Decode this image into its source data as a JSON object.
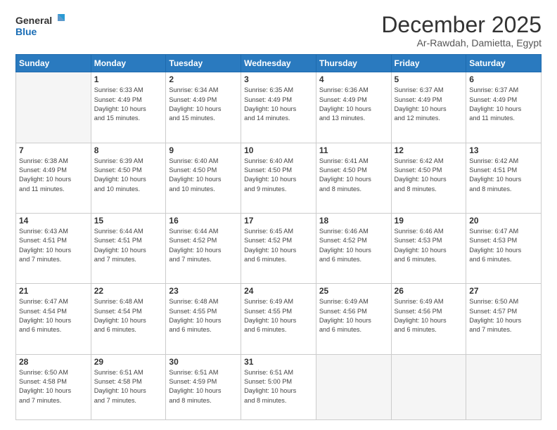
{
  "logo": {
    "line1": "General",
    "line2": "Blue"
  },
  "title": "December 2025",
  "location": "Ar-Rawdah, Damietta, Egypt",
  "days_of_week": [
    "Sunday",
    "Monday",
    "Tuesday",
    "Wednesday",
    "Thursday",
    "Friday",
    "Saturday"
  ],
  "weeks": [
    [
      {
        "day": "",
        "info": ""
      },
      {
        "day": "1",
        "info": "Sunrise: 6:33 AM\nSunset: 4:49 PM\nDaylight: 10 hours\nand 15 minutes."
      },
      {
        "day": "2",
        "info": "Sunrise: 6:34 AM\nSunset: 4:49 PM\nDaylight: 10 hours\nand 15 minutes."
      },
      {
        "day": "3",
        "info": "Sunrise: 6:35 AM\nSunset: 4:49 PM\nDaylight: 10 hours\nand 14 minutes."
      },
      {
        "day": "4",
        "info": "Sunrise: 6:36 AM\nSunset: 4:49 PM\nDaylight: 10 hours\nand 13 minutes."
      },
      {
        "day": "5",
        "info": "Sunrise: 6:37 AM\nSunset: 4:49 PM\nDaylight: 10 hours\nand 12 minutes."
      },
      {
        "day": "6",
        "info": "Sunrise: 6:37 AM\nSunset: 4:49 PM\nDaylight: 10 hours\nand 11 minutes."
      }
    ],
    [
      {
        "day": "7",
        "info": "Sunrise: 6:38 AM\nSunset: 4:49 PM\nDaylight: 10 hours\nand 11 minutes."
      },
      {
        "day": "8",
        "info": "Sunrise: 6:39 AM\nSunset: 4:50 PM\nDaylight: 10 hours\nand 10 minutes."
      },
      {
        "day": "9",
        "info": "Sunrise: 6:40 AM\nSunset: 4:50 PM\nDaylight: 10 hours\nand 10 minutes."
      },
      {
        "day": "10",
        "info": "Sunrise: 6:40 AM\nSunset: 4:50 PM\nDaylight: 10 hours\nand 9 minutes."
      },
      {
        "day": "11",
        "info": "Sunrise: 6:41 AM\nSunset: 4:50 PM\nDaylight: 10 hours\nand 8 minutes."
      },
      {
        "day": "12",
        "info": "Sunrise: 6:42 AM\nSunset: 4:50 PM\nDaylight: 10 hours\nand 8 minutes."
      },
      {
        "day": "13",
        "info": "Sunrise: 6:42 AM\nSunset: 4:51 PM\nDaylight: 10 hours\nand 8 minutes."
      }
    ],
    [
      {
        "day": "14",
        "info": "Sunrise: 6:43 AM\nSunset: 4:51 PM\nDaylight: 10 hours\nand 7 minutes."
      },
      {
        "day": "15",
        "info": "Sunrise: 6:44 AM\nSunset: 4:51 PM\nDaylight: 10 hours\nand 7 minutes."
      },
      {
        "day": "16",
        "info": "Sunrise: 6:44 AM\nSunset: 4:52 PM\nDaylight: 10 hours\nand 7 minutes."
      },
      {
        "day": "17",
        "info": "Sunrise: 6:45 AM\nSunset: 4:52 PM\nDaylight: 10 hours\nand 6 minutes."
      },
      {
        "day": "18",
        "info": "Sunrise: 6:46 AM\nSunset: 4:52 PM\nDaylight: 10 hours\nand 6 minutes."
      },
      {
        "day": "19",
        "info": "Sunrise: 6:46 AM\nSunset: 4:53 PM\nDaylight: 10 hours\nand 6 minutes."
      },
      {
        "day": "20",
        "info": "Sunrise: 6:47 AM\nSunset: 4:53 PM\nDaylight: 10 hours\nand 6 minutes."
      }
    ],
    [
      {
        "day": "21",
        "info": "Sunrise: 6:47 AM\nSunset: 4:54 PM\nDaylight: 10 hours\nand 6 minutes."
      },
      {
        "day": "22",
        "info": "Sunrise: 6:48 AM\nSunset: 4:54 PM\nDaylight: 10 hours\nand 6 minutes."
      },
      {
        "day": "23",
        "info": "Sunrise: 6:48 AM\nSunset: 4:55 PM\nDaylight: 10 hours\nand 6 minutes."
      },
      {
        "day": "24",
        "info": "Sunrise: 6:49 AM\nSunset: 4:55 PM\nDaylight: 10 hours\nand 6 minutes."
      },
      {
        "day": "25",
        "info": "Sunrise: 6:49 AM\nSunset: 4:56 PM\nDaylight: 10 hours\nand 6 minutes."
      },
      {
        "day": "26",
        "info": "Sunrise: 6:49 AM\nSunset: 4:56 PM\nDaylight: 10 hours\nand 6 minutes."
      },
      {
        "day": "27",
        "info": "Sunrise: 6:50 AM\nSunset: 4:57 PM\nDaylight: 10 hours\nand 7 minutes."
      }
    ],
    [
      {
        "day": "28",
        "info": "Sunrise: 6:50 AM\nSunset: 4:58 PM\nDaylight: 10 hours\nand 7 minutes."
      },
      {
        "day": "29",
        "info": "Sunrise: 6:51 AM\nSunset: 4:58 PM\nDaylight: 10 hours\nand 7 minutes."
      },
      {
        "day": "30",
        "info": "Sunrise: 6:51 AM\nSunset: 4:59 PM\nDaylight: 10 hours\nand 8 minutes."
      },
      {
        "day": "31",
        "info": "Sunrise: 6:51 AM\nSunset: 5:00 PM\nDaylight: 10 hours\nand 8 minutes."
      },
      {
        "day": "",
        "info": ""
      },
      {
        "day": "",
        "info": ""
      },
      {
        "day": "",
        "info": ""
      }
    ]
  ]
}
